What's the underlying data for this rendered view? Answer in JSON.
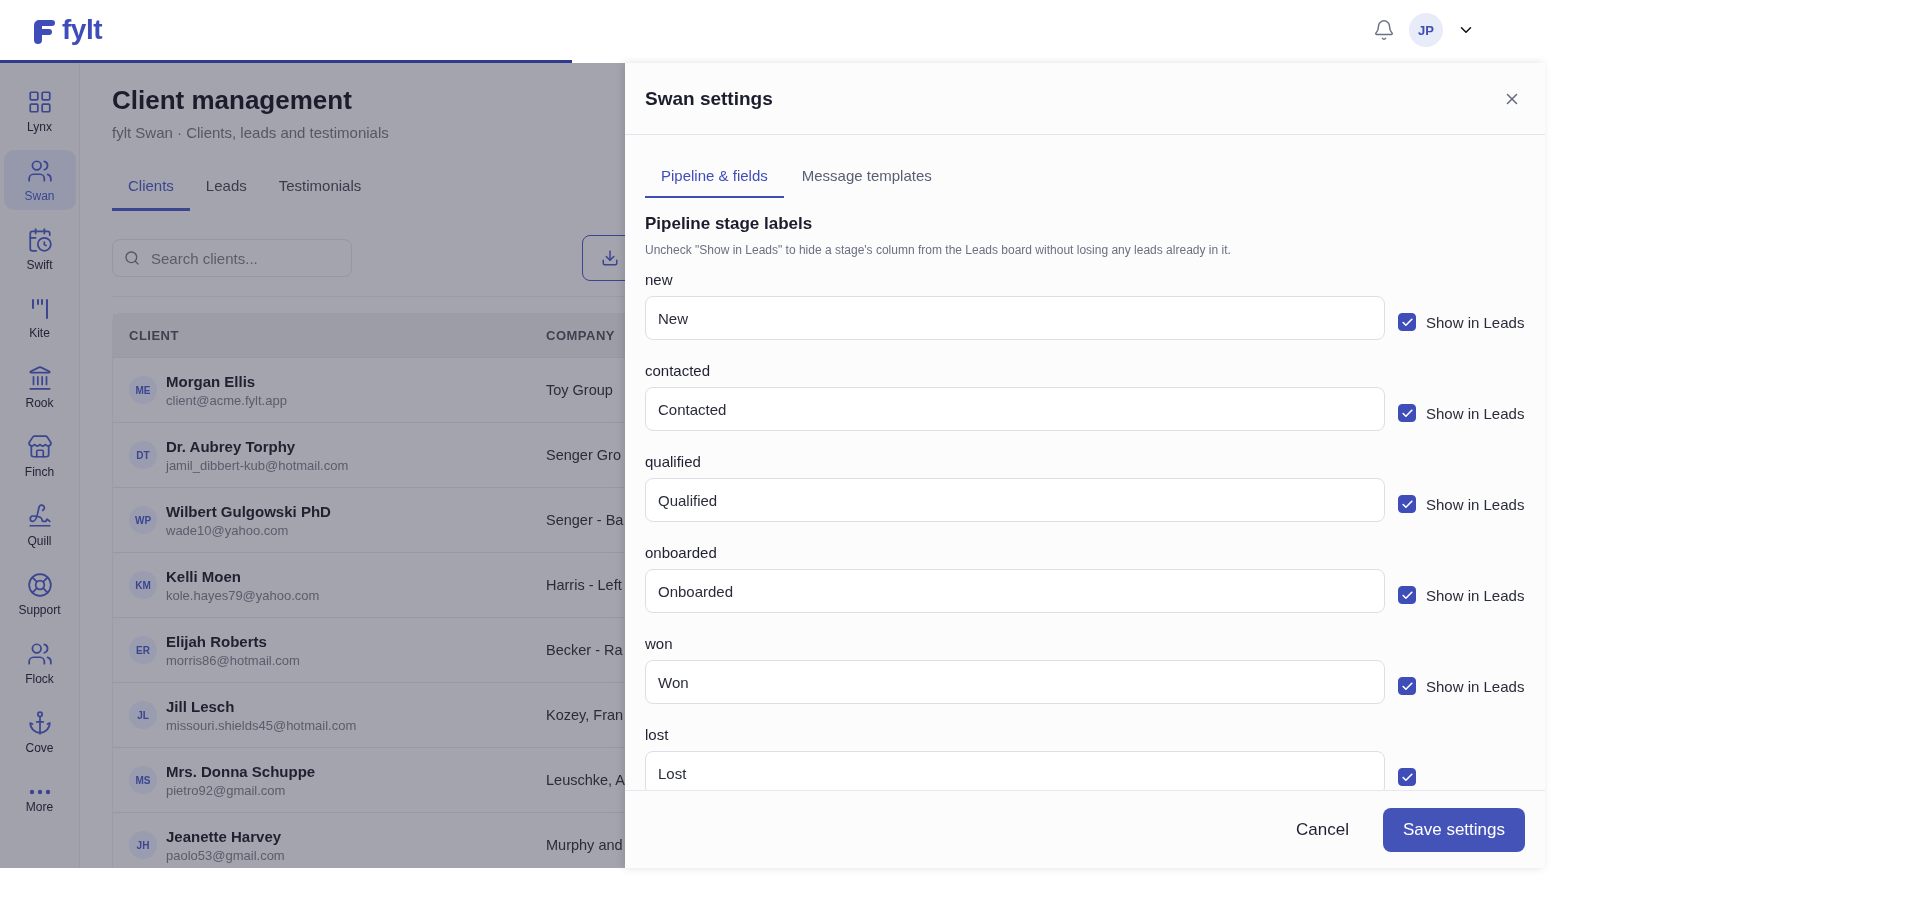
{
  "header": {
    "logo": "fylt",
    "avatar": "JP"
  },
  "loading_bar": {
    "level": 0.37
  },
  "sidebar": {
    "items": [
      {
        "label": "Lynx",
        "selected": false
      },
      {
        "label": "Swan",
        "selected": true
      },
      {
        "label": "Swift",
        "selected": false
      },
      {
        "label": "Kite",
        "selected": false
      },
      {
        "label": "Rook",
        "selected": false
      },
      {
        "label": "Finch",
        "selected": false
      },
      {
        "label": "Quill",
        "selected": false
      },
      {
        "label": "Support",
        "selected": false
      },
      {
        "label": "Flock",
        "selected": false
      },
      {
        "label": "Cove",
        "selected": false
      },
      {
        "label": "More",
        "selected": false
      }
    ]
  },
  "page": {
    "title": "Client management",
    "subtitle": "fylt Swan · Clients, leads and testimonials",
    "tabs": [
      {
        "label": "Clients",
        "selected": true
      },
      {
        "label": "Leads",
        "selected": false
      },
      {
        "label": "Testimonials",
        "selected": false
      }
    ],
    "search": {
      "placeholder": "Search clients..."
    }
  },
  "table": {
    "columns": [
      "CLIENT",
      "COMPANY"
    ],
    "rows": [
      {
        "initials": "ME",
        "name": "Morgan Ellis",
        "email": "client@acme.fylt.app",
        "company": "Toy Group"
      },
      {
        "initials": "DT",
        "name": "Dr. Aubrey Torphy",
        "email": "jamil_dibbert-kub@hotmail.com",
        "company": "Senger Gro"
      },
      {
        "initials": "WP",
        "name": "Wilbert Gulgowski PhD",
        "email": "wade10@yahoo.com",
        "company": "Senger - Ba"
      },
      {
        "initials": "KM",
        "name": "Kelli Moen",
        "email": "kole.hayes79@yahoo.com",
        "company": "Harris - Left"
      },
      {
        "initials": "ER",
        "name": "Elijah Roberts",
        "email": "morris86@hotmail.com",
        "company": "Becker - Ra"
      },
      {
        "initials": "JL",
        "name": "Jill Lesch",
        "email": "missouri.shields45@hotmail.com",
        "company": "Kozey, Fran"
      },
      {
        "initials": "MS",
        "name": "Mrs. Donna Schuppe",
        "email": "pietro92@gmail.com",
        "company": "Leuschke, A"
      },
      {
        "initials": "JH",
        "name": "Jeanette Harvey",
        "email": "paolo53@gmail.com",
        "company": "Murphy and"
      }
    ]
  },
  "modal": {
    "title": "Swan settings",
    "tabs": [
      {
        "label": "Pipeline & fields",
        "selected": true
      },
      {
        "label": "Message templates",
        "selected": false
      }
    ],
    "section_title": "Pipeline stage labels",
    "description": "Uncheck \"Show in Leads\" to hide a stage's column from the Leads board without losing any leads already in it.",
    "stages": [
      {
        "key": "new",
        "value": "New",
        "checked": true,
        "show_label": "Show in Leads"
      },
      {
        "key": "contacted",
        "value": "Contacted",
        "checked": true,
        "show_label": "Show in Leads"
      },
      {
        "key": "qualified",
        "value": "Qualified",
        "checked": true,
        "show_label": "Show in Leads"
      },
      {
        "key": "onboarded",
        "value": "Onboarded",
        "checked": true,
        "show_label": "Show in Leads"
      },
      {
        "key": "won",
        "value": "Won",
        "checked": true,
        "show_label": "Show in Leads"
      },
      {
        "key": "lost",
        "value": "Lost",
        "checked": true
      }
    ],
    "buttons": {
      "cancel": "Cancel",
      "save": "Save settings"
    }
  }
}
